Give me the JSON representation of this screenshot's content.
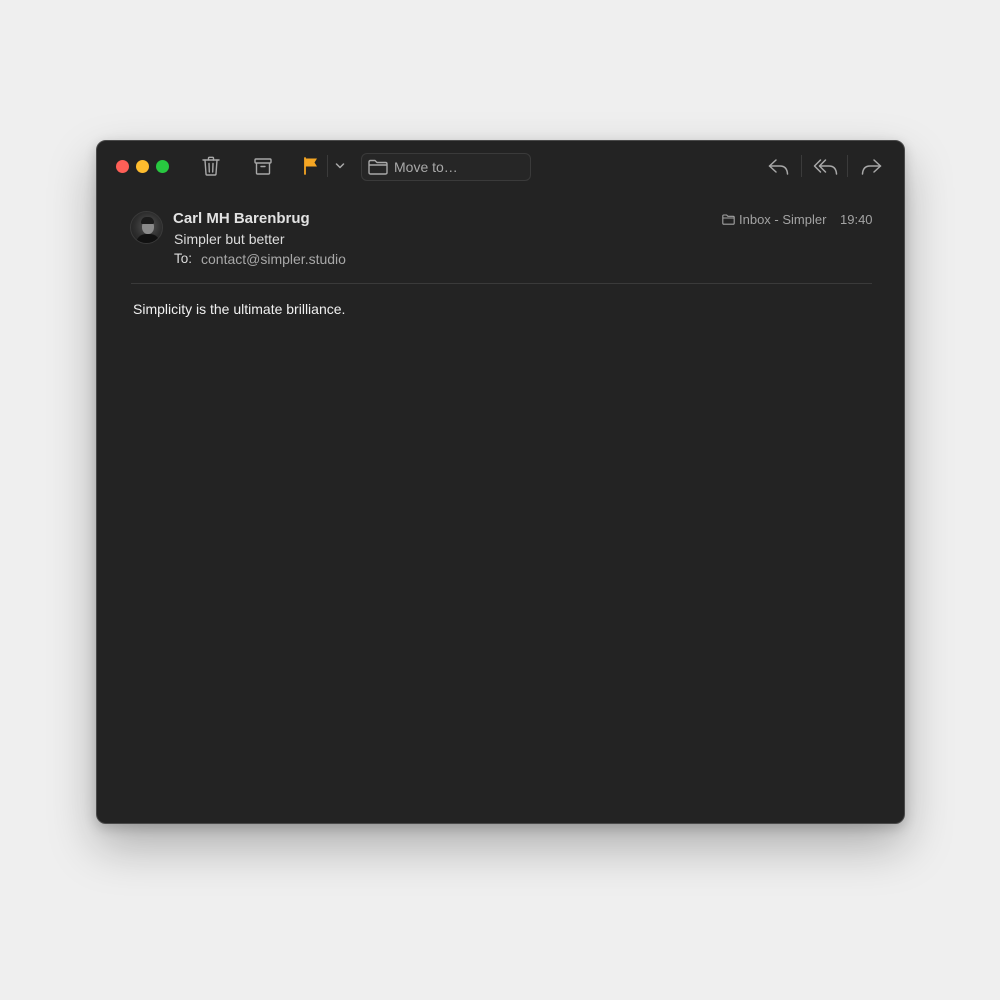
{
  "toolbar": {
    "move_to_label": "Move to…",
    "flag_color": "#f5a623"
  },
  "message": {
    "sender": "Carl MH Barenbrug",
    "subject": "Simpler but better",
    "to_label": "To:",
    "to_address": "contact@simpler.studio",
    "mailbox": "Inbox - Simpler",
    "time": "19:40",
    "body": "Simplicity is the ultimate brilliance."
  },
  "icons": {
    "close": "close-icon",
    "minimize": "minimize-icon",
    "maximize": "maximize-icon",
    "trash": "trash-icon",
    "archive": "archive-icon",
    "flag": "flag-icon",
    "flag_menu": "chevron-down-icon",
    "folder": "folder-icon",
    "reply": "reply-icon",
    "reply_all": "reply-all-icon",
    "forward": "forward-icon"
  }
}
